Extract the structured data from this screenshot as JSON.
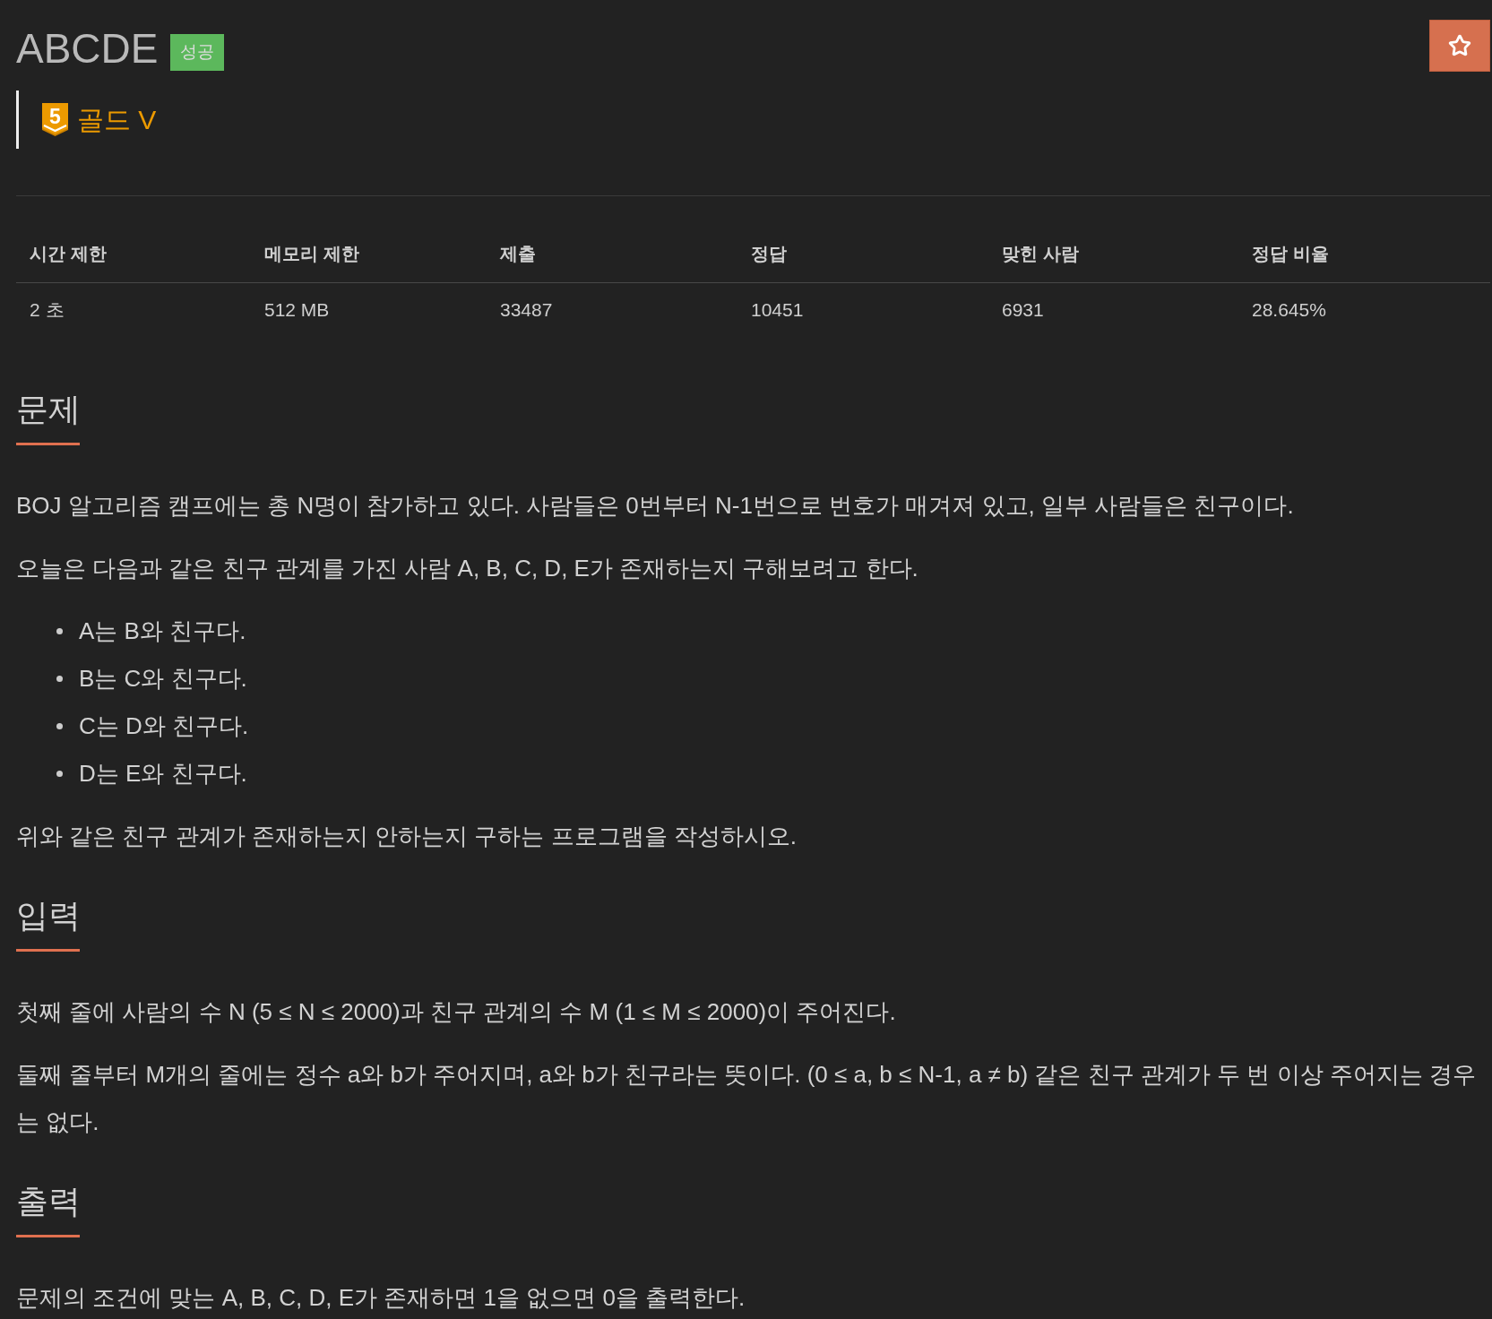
{
  "problem": {
    "title": "ABCDE",
    "result_badge": "성공",
    "tier": {
      "number": "5",
      "name": "골드 V"
    }
  },
  "stats": {
    "columns": [
      "시간 제한",
      "메모리 제한",
      "제출",
      "정답",
      "맞힌 사람",
      "정답 비율"
    ],
    "rows": [
      [
        "2 초",
        "512 MB",
        "33487",
        "10451",
        "6931",
        "28.645%"
      ]
    ]
  },
  "sections": [
    {
      "heading": "문제",
      "blocks": [
        {
          "kind": "paragraph",
          "text": "BOJ 알고리즘 캠프에는 총 N명이 참가하고 있다. 사람들은 0번부터 N-1번으로 번호가 매겨져 있고, 일부 사람들은 친구이다."
        },
        {
          "kind": "paragraph",
          "text": "오늘은 다음과 같은 친구 관계를 가진 사람 A, B, C, D, E가 존재하는지 구해보려고 한다."
        },
        {
          "kind": "list",
          "items": [
            "A는 B와 친구다.",
            "B는 C와 친구다.",
            "C는 D와 친구다.",
            "D는 E와 친구다."
          ]
        },
        {
          "kind": "paragraph",
          "text": "위와 같은 친구 관계가 존재하는지 안하는지 구하는 프로그램을 작성하시오."
        }
      ]
    },
    {
      "heading": "입력",
      "blocks": [
        {
          "kind": "paragraph",
          "text": "첫째 줄에 사람의 수 N (5 ≤ N ≤ 2000)과 친구 관계의 수 M (1 ≤ M ≤ 2000)이 주어진다."
        },
        {
          "kind": "paragraph",
          "text": "둘째 줄부터 M개의 줄에는 정수 a와 b가 주어지며, a와 b가 친구라는 뜻이다. (0 ≤ a, b ≤ N-1, a ≠ b) 같은 친구 관계가 두 번 이상 주어지는 경우는 없다."
        }
      ]
    },
    {
      "heading": "출력",
      "blocks": [
        {
          "kind": "paragraph",
          "text": "문제의 조건에 맞는 A, B, C, D, E가 존재하면 1을 없으면 0을 출력한다."
        }
      ]
    }
  ]
}
